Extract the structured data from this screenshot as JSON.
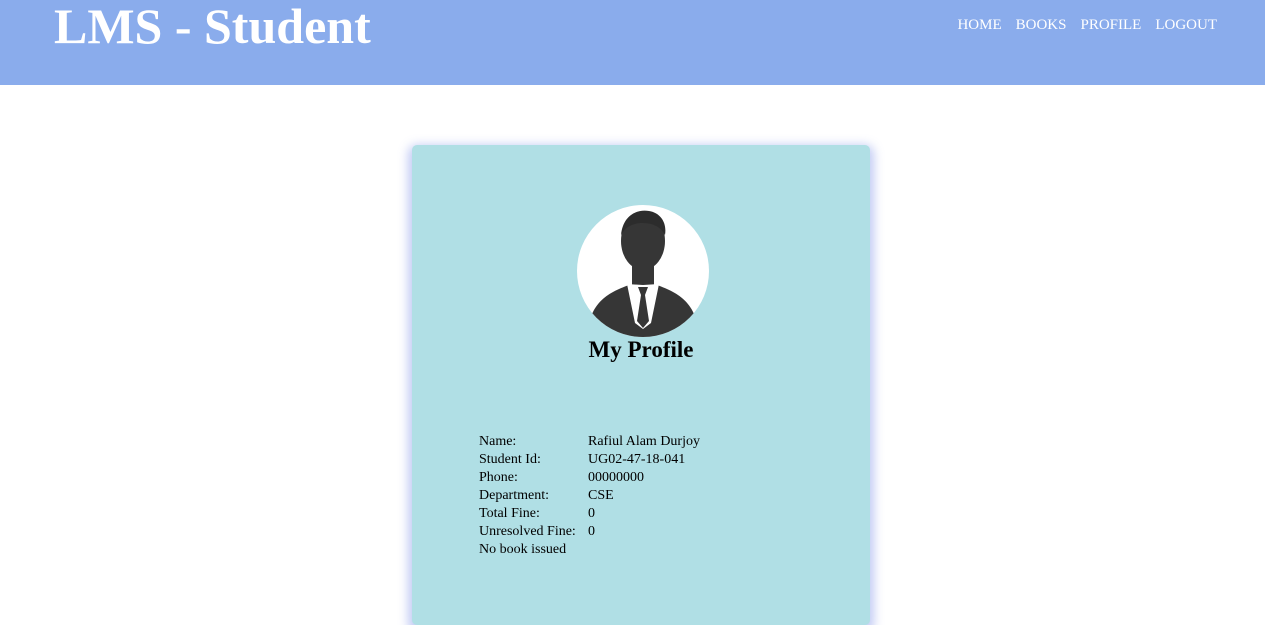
{
  "header": {
    "title": "LMS - Student",
    "nav": [
      "HOME",
      "BOOKS",
      "PROFILE",
      "LOGOUT"
    ]
  },
  "profile": {
    "heading": "My Profile",
    "avatar_icon": "user-silhouette-icon",
    "fields": [
      {
        "label": "Name:",
        "value": "Rafiul Alam Durjoy"
      },
      {
        "label": "Student Id:",
        "value": "UG02-47-18-041"
      },
      {
        "label": "Phone:",
        "value": "00000000"
      },
      {
        "label": "Department:",
        "value": "CSE"
      },
      {
        "label": "Total Fine:",
        "value": "0"
      },
      {
        "label": "Unresolved Fine:",
        "value": "0"
      }
    ],
    "issued_status": "No book issued"
  },
  "colors": {
    "header_bg": "#8aacec",
    "card_bg": "#b0dfe5",
    "text": "#000000",
    "header_text": "#ffffff"
  }
}
